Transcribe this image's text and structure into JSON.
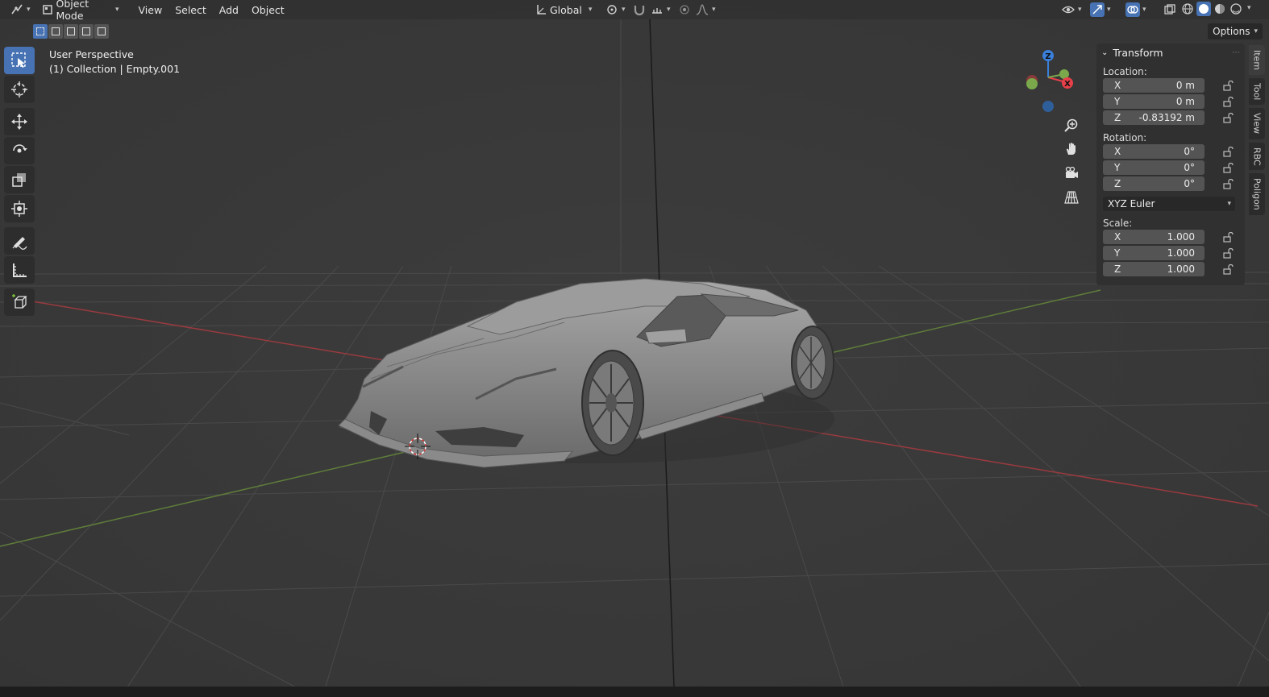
{
  "header": {
    "editor_icon": "viewport-editor-icon",
    "mode": "Object Mode",
    "menus": [
      "View",
      "Select",
      "Add",
      "Object"
    ],
    "orientation": "Global"
  },
  "subheader": {
    "options_label": "Options"
  },
  "viewport": {
    "title": "User Perspective",
    "subtitle": "(1) Collection | Empty.001"
  },
  "gizmo": {
    "z_label": "Z",
    "x_label": "X"
  },
  "npanel": {
    "panel_title": "Transform",
    "location_label": "Location:",
    "location": [
      {
        "axis": "X",
        "value": "0 m"
      },
      {
        "axis": "Y",
        "value": "0 m"
      },
      {
        "axis": "Z",
        "value": "-0.83192 m"
      }
    ],
    "rotation_label": "Rotation:",
    "rotation": [
      {
        "axis": "X",
        "value": "0°"
      },
      {
        "axis": "Y",
        "value": "0°"
      },
      {
        "axis": "Z",
        "value": "0°"
      }
    ],
    "rotation_mode": "XYZ Euler",
    "scale_label": "Scale:",
    "scale": [
      {
        "axis": "X",
        "value": "1.000"
      },
      {
        "axis": "Y",
        "value": "1.000"
      },
      {
        "axis": "Z",
        "value": "1.000"
      }
    ]
  },
  "sidetabs": [
    "Item",
    "Tool",
    "View",
    "RBC",
    "Poligon"
  ],
  "colors": {
    "accent": "#4772b3",
    "x_axis": "#e8404a",
    "y_axis": "#7aa84b",
    "z_axis": "#3a7fd9"
  }
}
